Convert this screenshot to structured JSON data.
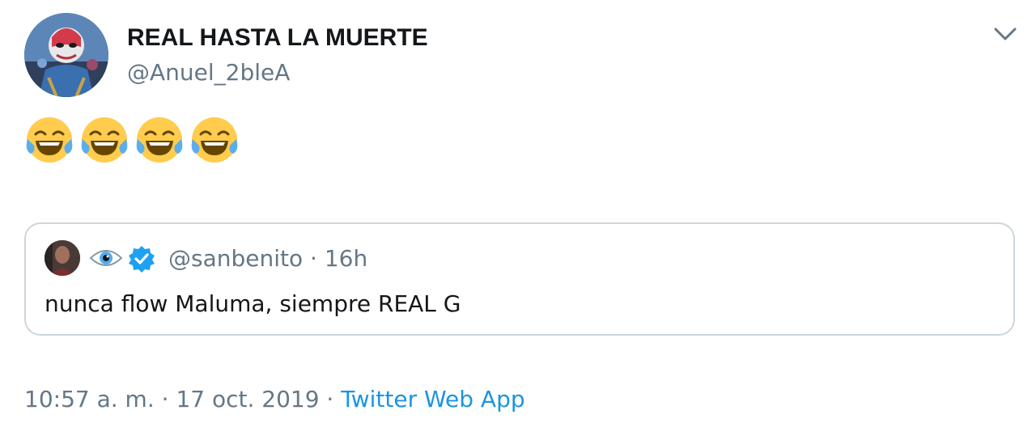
{
  "author": {
    "display_name": "REAL HASTA LA MUERTE",
    "handle": "@Anuel_2bleA",
    "avatar": "profile-avatar"
  },
  "tweet": {
    "emojis": [
      "face-with-tears-of-joy",
      "face-with-tears-of-joy",
      "face-with-tears-of-joy",
      "face-with-tears-of-joy"
    ]
  },
  "quoted_tweet": {
    "avatar": "quoted-profile-avatar",
    "display_icon": "eye-icon",
    "verified": true,
    "handle": "@sanbenito",
    "separator": " · ",
    "age": "16h",
    "text": "nunca flow Maluma, siempre REAL G"
  },
  "meta": {
    "time": "10:57 a. m.",
    "date": "17 oct. 2019",
    "separator": " · ",
    "source": "Twitter Web App"
  },
  "icons": {
    "caret": "chevron-down-icon"
  },
  "colors": {
    "text": "#14171a",
    "secondary": "#657786",
    "link": "#1b95e0",
    "border": "#ccd6dd",
    "verified": "#1da1f2"
  }
}
